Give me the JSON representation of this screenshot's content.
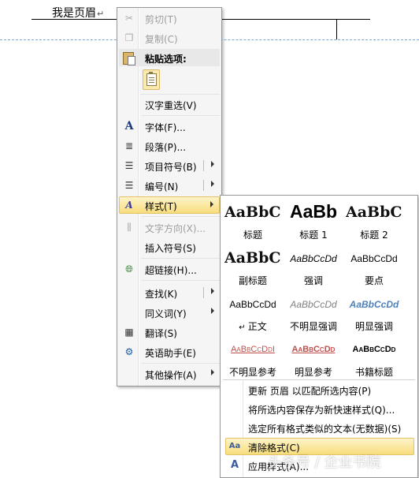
{
  "document": {
    "header_text": "我是页眉",
    "paragraph_mark": "↵"
  },
  "context_menu": {
    "cut": "剪切(T)",
    "copy": "复制(C)",
    "paste_options": "粘贴选项:",
    "reconvert": "汉字重选(V)",
    "font": "字体(F)...",
    "paragraph": "段落(P)...",
    "bullets": "项目符号(B)",
    "numbering": "编号(N)",
    "styles": "样式(T)",
    "text_direction": "文字方向(X)...",
    "insert_symbol": "插入符号(S)",
    "hyperlink": "超链接(H)...",
    "lookup": "查找(K)",
    "synonyms": "同义词(Y)",
    "translate": "翻译(S)",
    "english_assistant": "英语助手(E)",
    "other_actions": "其他操作(A)"
  },
  "styles_gallery": {
    "styles": [
      {
        "preview": "AaBbC(",
        "name": "标题"
      },
      {
        "preview": "AaBb",
        "name": "标题 1"
      },
      {
        "preview": "AaBbC(",
        "name": "标题 2"
      },
      {
        "preview": "AaBbC(",
        "name": "副标题"
      },
      {
        "preview": "AaBbCcDd",
        "name": "强调"
      },
      {
        "preview": "AaBbCcDd",
        "name": "要点"
      },
      {
        "preview": "AaBbCcDd",
        "name": "正文",
        "prefix": "↵"
      },
      {
        "preview": "AaBbCcDd",
        "name": "不明显强调"
      },
      {
        "preview": "AaBbCcDd",
        "name": "明显强调"
      },
      {
        "preview": "AaBbCcDdI",
        "name": "不明显参考"
      },
      {
        "preview": "AaBbCcDd",
        "name": "明显参考"
      },
      {
        "preview": "AaBbCcDd",
        "name": "书籍标题"
      }
    ],
    "actions": {
      "update_style": "更新 页眉 以匹配所选内容(P)",
      "save_as_quick_style": "将所选内容保存为新快速样式(Q)...",
      "select_all_similar": "选定所有格式类似的文本(无数据)(S)",
      "clear_formatting": "清除格式(C)",
      "apply_styles": "应用样式(A)..."
    }
  },
  "watermark": "头条号 / 企业书院",
  "colors": {
    "highlight": "#f8dd7d",
    "menu_bg": "#f5f5f5",
    "disabled_text": "#9d9d9d"
  }
}
